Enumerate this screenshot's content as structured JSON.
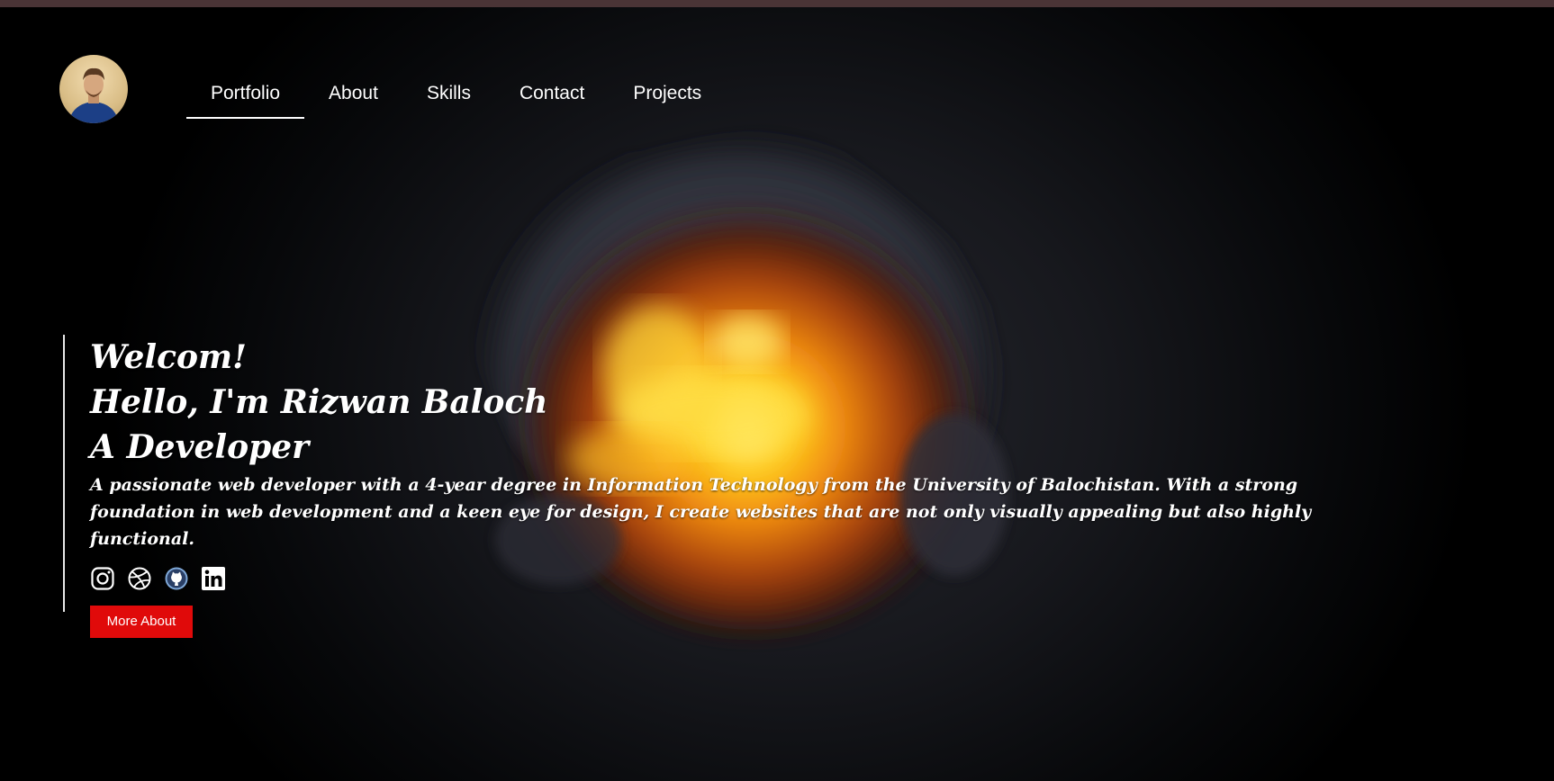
{
  "nav": {
    "items": [
      {
        "label": "Portfolio",
        "active": true
      },
      {
        "label": "About",
        "active": false
      },
      {
        "label": "Skills",
        "active": false
      },
      {
        "label": "Contact",
        "active": false
      },
      {
        "label": "Projects",
        "active": false
      }
    ]
  },
  "hero": {
    "line1": "Welcom!",
    "line2": "Hello, I'm Rizwan Baloch",
    "line3": "A Developer",
    "bio": "A passionate web developer with a 4-year degree in Information Technology from the University of Balochistan. With a strong foundation in web development and a keen eye for design, I create websites that are not only visually appealing but also highly functional.",
    "button_label": "More About"
  },
  "socials": [
    {
      "icon": "instagram-icon"
    },
    {
      "icon": "dribbble-icon"
    },
    {
      "icon": "github-icon"
    },
    {
      "icon": "linkedin-icon"
    }
  ],
  "colors": {
    "accent": "#e00a0a",
    "background": "#000000",
    "top_strip": "#4a3436",
    "text": "#ffffff"
  }
}
